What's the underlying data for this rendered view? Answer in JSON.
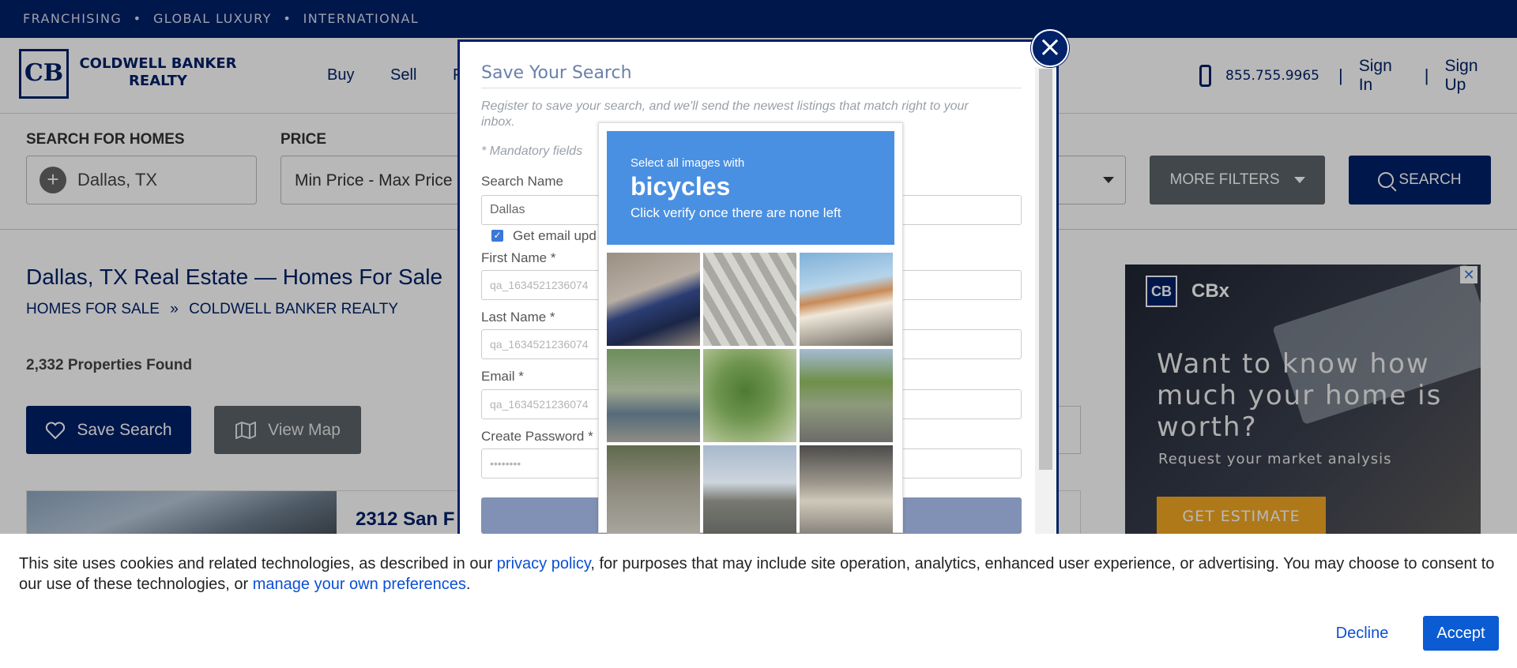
{
  "topbar": {
    "links": [
      "FRANCHISING",
      "GLOBAL LUXURY",
      "INTERNATIONAL"
    ],
    "separator": "•"
  },
  "header": {
    "logo_monogram": "CB",
    "logo_line1": "COLDWELL BANKER",
    "logo_line2": "REALTY",
    "nav": [
      "Buy",
      "Sell",
      "F"
    ],
    "phone": "855.755.9965",
    "sep": "|",
    "sign_in": "Sign In",
    "sign_up": "Sign Up"
  },
  "filters": {
    "search_label": "SEARCH FOR HOMES",
    "location_value": "Dallas, TX",
    "price_label": "PRICE",
    "price_value": "Min Price  -  Max Price",
    "more_filters": "MORE FILTERS",
    "search_button": "SEARCH"
  },
  "results": {
    "page_title": "Dallas, TX Real Estate — Homes For Sale",
    "breadcrumb_home": "HOMES FOR SALE",
    "breadcrumb_sep": "»",
    "breadcrumb_current": "COLDWELL BANKER REALTY",
    "count": "2,332 Properties Found",
    "save_search": "Save Search",
    "view_map": "View Map",
    "listing_title": "2312 San F"
  },
  "ad": {
    "logo": "CB",
    "brand": "CBx",
    "close": "✕",
    "headline": "Want to know how much your home is worth?",
    "subline": "Request your market analysis",
    "button": "GET ESTIMATE"
  },
  "modal": {
    "title": "Save Your Search",
    "description": "Register to save your search, and we'll send the newest listings that match right to your inbox.",
    "mandatory": "* Mandatory fields",
    "search_name_label": "Search Name",
    "search_name_value": "Dallas",
    "email_updates_label": "Get email upd",
    "first_name_label": "First Name *",
    "first_name_value": "qa_1634521236074",
    "last_name_label": "Last Name *",
    "last_name_value": "qa_1634521236074",
    "email_label": "Email *",
    "email_value": "qa_1634521236074",
    "password_label": "Create Password *",
    "password_value": "••••••••",
    "close": "×"
  },
  "captcha": {
    "select_text": "Select all images with",
    "target": "bicycles",
    "instruction": "Click verify once there are none left"
  },
  "cookie": {
    "text_before": "This site uses cookies and related technologies, as described in our ",
    "privacy_link": "privacy policy",
    "text_middle": ", for purposes that may include site operation, analytics, enhanced user experience, or advertising. You may choose to consent to our use of these technologies, or ",
    "manage_link": "manage your own preferences",
    "text_after": ".",
    "decline": "Decline",
    "accept": "Accept"
  }
}
